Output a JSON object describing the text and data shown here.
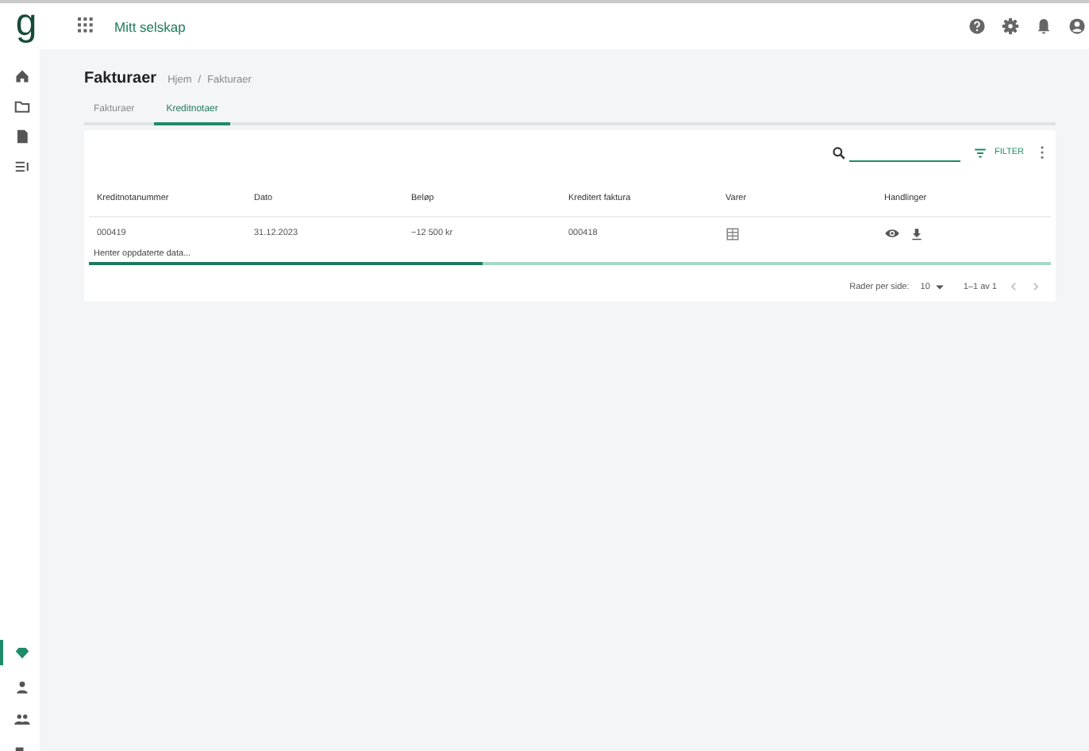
{
  "logo": "g",
  "app_title": "Mitt selskap",
  "sidebar": {
    "top_items": [
      {
        "selected": false
      },
      {
        "selected": false
      },
      {
        "selected": false
      },
      {
        "selected": false
      }
    ],
    "bottom_items": [
      {
        "selected": true
      },
      {
        "selected": false
      },
      {
        "selected": false
      },
      {
        "selected": false
      }
    ]
  },
  "page_title": "Fakturaer",
  "breadcrumb": [
    "Hjem",
    "Fakturaer"
  ],
  "breadcrumb_separator": "/",
  "tabs": [
    {
      "label": "Fakturaer",
      "selected": false
    },
    {
      "label": "Kreditnotaer",
      "selected": true
    }
  ],
  "toolbar": {
    "filter_label": "FILTER"
  },
  "table": {
    "columns": [
      "Kreditnotanummer",
      "Dato",
      "Beløp",
      "Kreditert faktura",
      "Varer",
      "Handlinger"
    ],
    "rows": [
      {
        "cells": [
          "000419",
          "31.12.2023",
          "−12 500 kr",
          "000418"
        ]
      }
    ]
  },
  "loading": {
    "text": "Henter oppdaterte data...",
    "level": 0.41
  },
  "pagination": {
    "rows_per_page_label": "Rader per side:",
    "rows_per_page": "10",
    "range": "1–1 av 1"
  }
}
